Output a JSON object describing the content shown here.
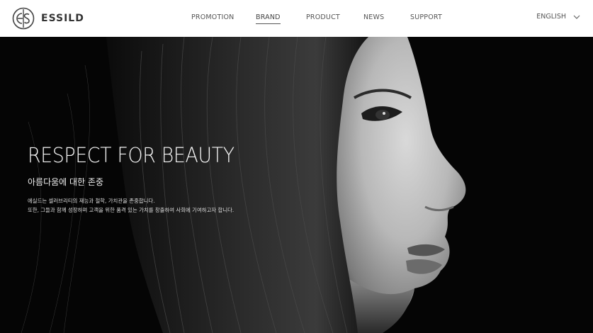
{
  "brand": {
    "name": "ESSILD"
  },
  "nav": {
    "items": [
      {
        "label": "PROMOTION"
      },
      {
        "label": "BRAND",
        "active": true
      },
      {
        "label": "PRODUCT"
      },
      {
        "label": "NEWS"
      },
      {
        "label": "SUPPORT"
      }
    ]
  },
  "language": {
    "label": "ENGLISH",
    "icon": "chevron-down-icon"
  },
  "hero": {
    "title": "RESPECT FOR BEAUTY",
    "subtitle": "아름다움에 대한 존중",
    "description": [
      "에실드는 셀러브리티의 재능과 철학, 가치관을 존중합니다.",
      "또한, 그들과 함께 성장하며 고객을 위한 품격 있는 가치를 창출하여 사회에 기여하고자 합니다."
    ]
  },
  "colors": {
    "header_bg": "#ffffff",
    "hero_bg": "#050505",
    "text_light": "#f4f4f4"
  }
}
